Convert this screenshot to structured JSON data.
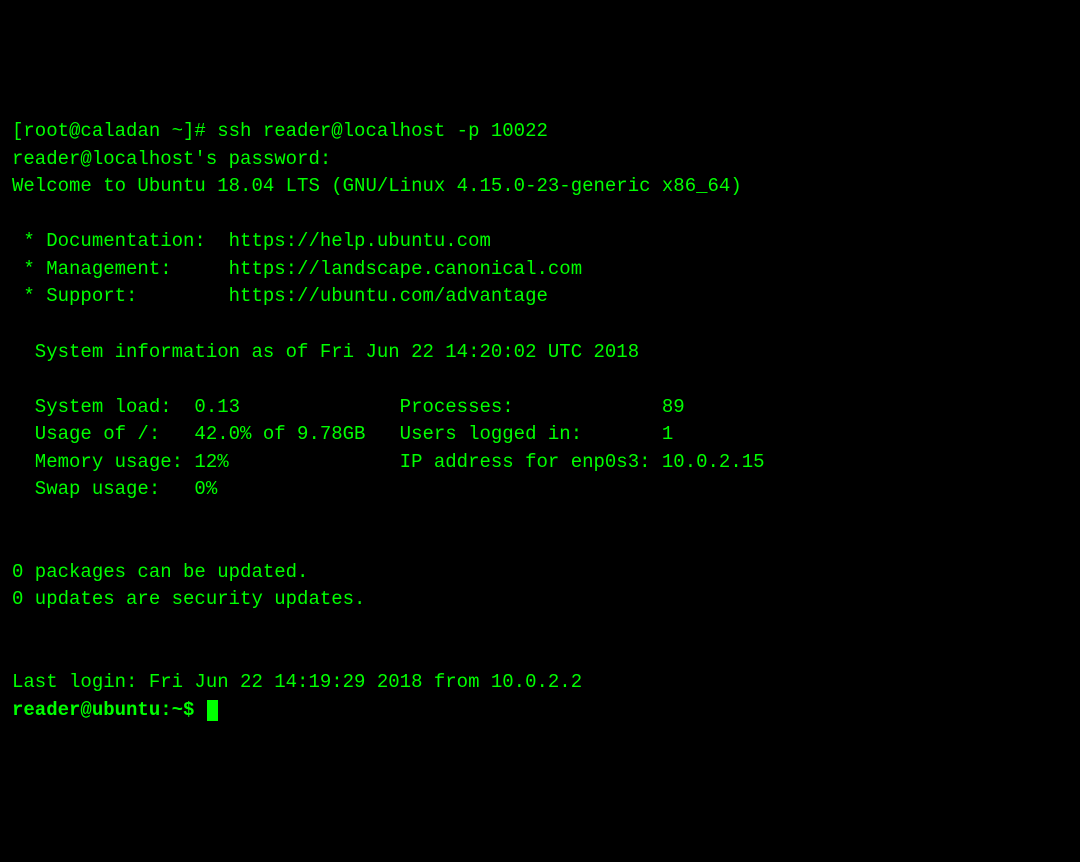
{
  "line1": "[root@caladan ~]# ssh reader@localhost -p 10022",
  "line2": "reader@localhost's password:",
  "line3": "Welcome to Ubuntu 18.04 LTS (GNU/Linux 4.15.0-23-generic x86_64)",
  "blank1": "",
  "line4": " * Documentation:  https://help.ubuntu.com",
  "line5": " * Management:     https://landscape.canonical.com",
  "line6": " * Support:        https://ubuntu.com/advantage",
  "blank2": "",
  "line7": "  System information as of Fri Jun 22 14:20:02 UTC 2018",
  "blank3": "",
  "line8": "  System load:  0.13              Processes:             89",
  "line9": "  Usage of /:   42.0% of 9.78GB   Users logged in:       1",
  "line10": "  Memory usage: 12%               IP address for enp0s3: 10.0.2.15",
  "line11": "  Swap usage:   0%",
  "blank4": "",
  "blank5": "",
  "line12": "0 packages can be updated.",
  "line13": "0 updates are security updates.",
  "blank6": "",
  "blank7": "",
  "line14": "Last login: Fri Jun 22 14:19:29 2018 from 10.0.2.2",
  "prompt_user_host": "reader@ubuntu",
  "prompt_colon": ":",
  "prompt_tilde": "~",
  "prompt_dollar": "$",
  "prompt_space": " "
}
